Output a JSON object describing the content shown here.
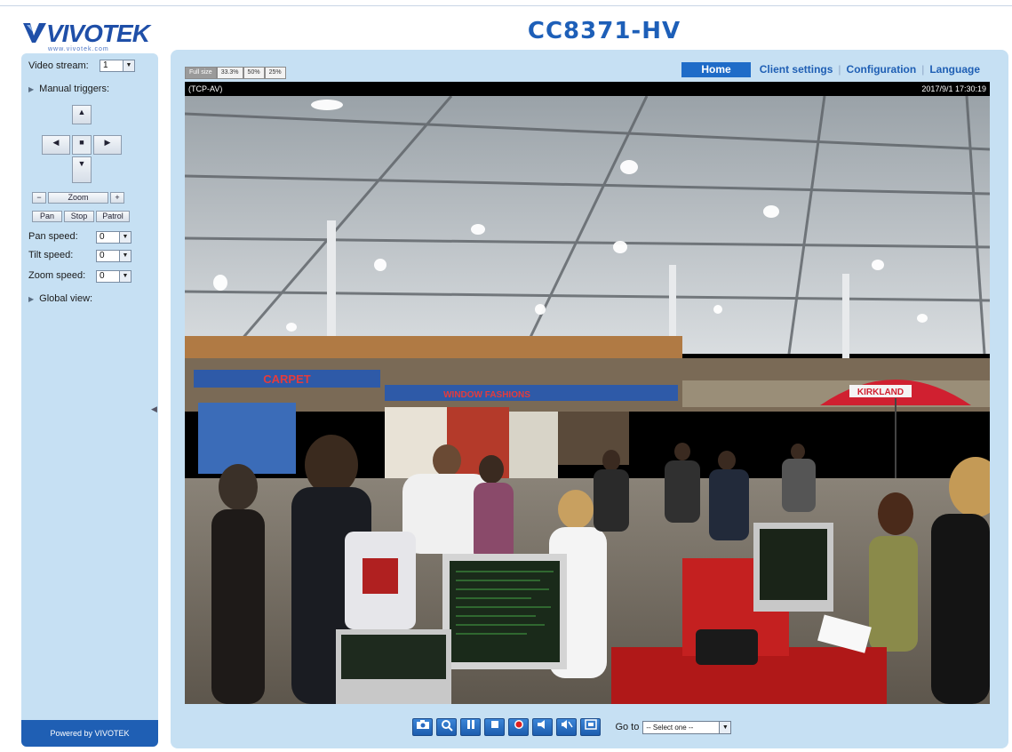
{
  "header": {
    "logo_text": "VIVOTEK",
    "logo_sub": "www.vivotek.com",
    "model": "CC8371-HV"
  },
  "sidebar": {
    "video_stream_label": "Video stream:",
    "video_stream_value": "1",
    "manual_triggers_label": "Manual triggers:",
    "zoom_label": "Zoom",
    "zoom_minus": "−",
    "zoom_plus": "+",
    "pan_label": "Pan",
    "stop_label": "Stop",
    "patrol_label": "Patrol",
    "pan_speed_label": "Pan speed:",
    "pan_speed_value": "0",
    "tilt_speed_label": "Tilt speed:",
    "tilt_speed_value": "0",
    "zoom_speed_label": "Zoom speed:",
    "zoom_speed_value": "0",
    "global_view_label": "Global view:",
    "powered_by": "Powered by VIVOTEK"
  },
  "size_tabs": [
    "Full size",
    "33.3%",
    "50%",
    "25%"
  ],
  "nav": {
    "home": "Home",
    "client_settings": "Client settings",
    "configuration": "Configuration",
    "language": "Language"
  },
  "video": {
    "protocol": "(TCP-AV)",
    "timestamp": "2017/9/1 17:30:19"
  },
  "controls": {
    "goto_label": "Go to",
    "goto_value": "-- Select one --"
  },
  "icons": {
    "snapshot": "camera-icon",
    "digital_zoom": "zoom-icon",
    "pause": "pause-icon",
    "stop": "stop-icon",
    "record": "record-icon",
    "volume": "volume-icon",
    "mute": "mute-icon",
    "fullscreen": "fullscreen-icon"
  },
  "colors": {
    "brand_blue": "#1f5fb4",
    "panel_bg": "#c6e0f3",
    "umbrella_red": "#d02030"
  }
}
